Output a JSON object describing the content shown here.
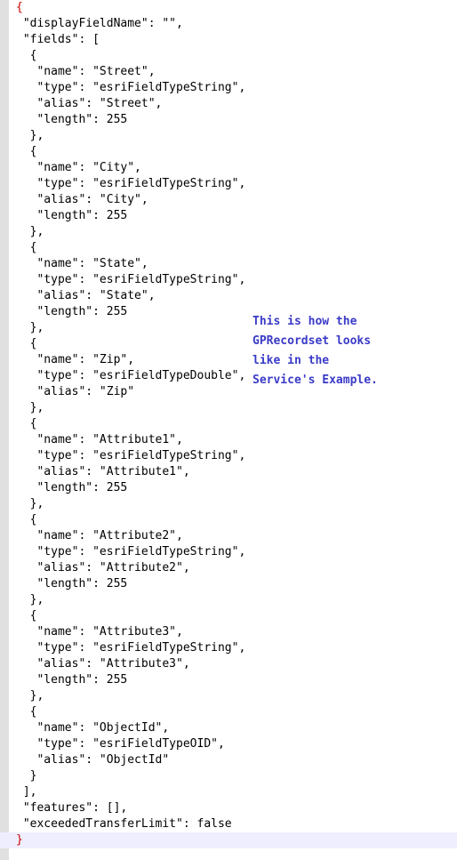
{
  "document": {
    "type": "json-code-listing",
    "language": "json",
    "gutter_color": "#e0e0e0",
    "background_color": "#ffffff",
    "text_color": "#000000",
    "brace_highlight_color": "#cc0000",
    "brace_highlight_background": "#eeeeff"
  },
  "annotation": {
    "color": "#3a3ac8",
    "lines": [
      "This is how the",
      "GPRecordset looks",
      "like in the",
      "Service's Example."
    ]
  },
  "code": {
    "lines": [
      {
        "text": "{",
        "highlight": true,
        "no_bg": true
      },
      {
        "text": " \"displayFieldName\": \"\","
      },
      {
        "text": " \"fields\": ["
      },
      {
        "text": "  {"
      },
      {
        "text": "   \"name\": \"Street\","
      },
      {
        "text": "   \"type\": \"esriFieldTypeString\","
      },
      {
        "text": "   \"alias\": \"Street\","
      },
      {
        "text": "   \"length\": 255"
      },
      {
        "text": "  },"
      },
      {
        "text": "  {"
      },
      {
        "text": "   \"name\": \"City\","
      },
      {
        "text": "   \"type\": \"esriFieldTypeString\","
      },
      {
        "text": "   \"alias\": \"City\","
      },
      {
        "text": "   \"length\": 255"
      },
      {
        "text": "  },"
      },
      {
        "text": "  {"
      },
      {
        "text": "   \"name\": \"State\","
      },
      {
        "text": "   \"type\": \"esriFieldTypeString\","
      },
      {
        "text": "   \"alias\": \"State\","
      },
      {
        "text": "   \"length\": 255"
      },
      {
        "text": "  },"
      },
      {
        "text": "  {"
      },
      {
        "text": "   \"name\": \"Zip\","
      },
      {
        "text": "   \"type\": \"esriFieldTypeDouble\","
      },
      {
        "text": "   \"alias\": \"Zip\""
      },
      {
        "text": "  },"
      },
      {
        "text": "  {"
      },
      {
        "text": "   \"name\": \"Attribute1\","
      },
      {
        "text": "   \"type\": \"esriFieldTypeString\","
      },
      {
        "text": "   \"alias\": \"Attribute1\","
      },
      {
        "text": "   \"length\": 255"
      },
      {
        "text": "  },"
      },
      {
        "text": "  {"
      },
      {
        "text": "   \"name\": \"Attribute2\","
      },
      {
        "text": "   \"type\": \"esriFieldTypeString\","
      },
      {
        "text": "   \"alias\": \"Attribute2\","
      },
      {
        "text": "   \"length\": 255"
      },
      {
        "text": "  },"
      },
      {
        "text": "  {"
      },
      {
        "text": "   \"name\": \"Attribute3\","
      },
      {
        "text": "   \"type\": \"esriFieldTypeString\","
      },
      {
        "text": "   \"alias\": \"Attribute3\","
      },
      {
        "text": "   \"length\": 255"
      },
      {
        "text": "  },"
      },
      {
        "text": "  {"
      },
      {
        "text": "   \"name\": \"ObjectId\","
      },
      {
        "text": "   \"type\": \"esriFieldTypeOID\","
      },
      {
        "text": "   \"alias\": \"ObjectId\""
      },
      {
        "text": "  }"
      },
      {
        "text": " ],"
      },
      {
        "text": " \"features\": [],"
      },
      {
        "text": " \"exceededTransferLimit\": false"
      },
      {
        "text": "}",
        "highlight": true
      }
    ]
  }
}
